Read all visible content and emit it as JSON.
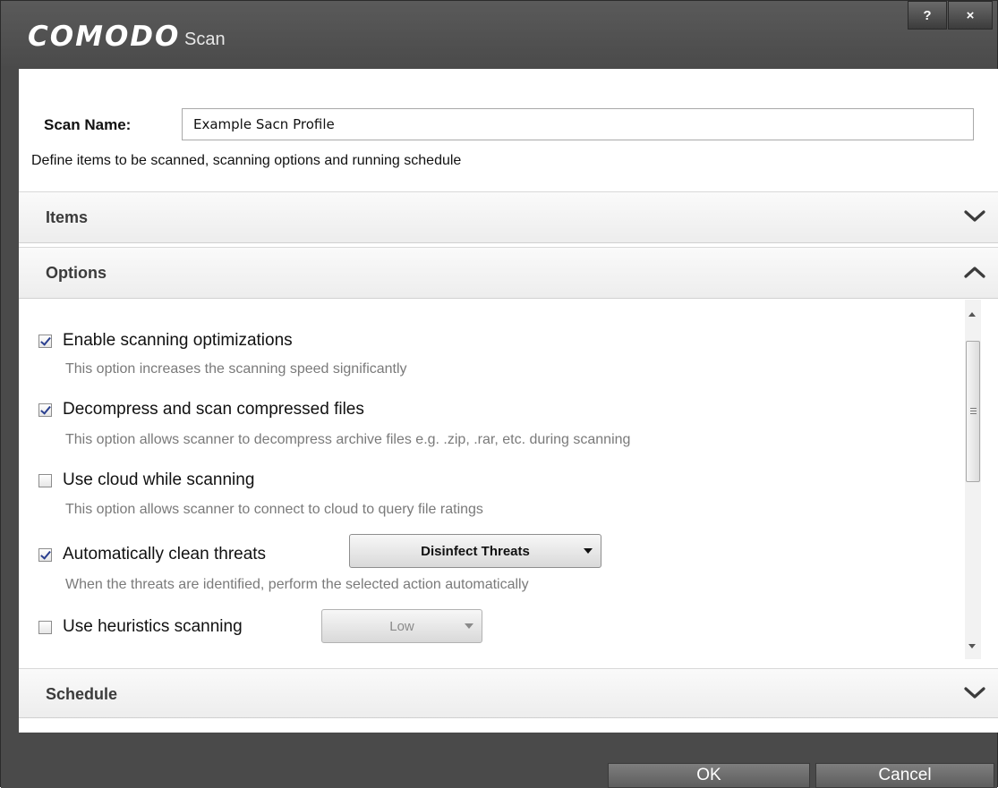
{
  "window": {
    "brand": "COMODO",
    "title": "Scan",
    "help_label": "?",
    "close_label": "×"
  },
  "scan": {
    "name_label": "Scan Name:",
    "name_value": "Example Sacn Profile",
    "description": "Define items to be scanned, scanning options and running schedule"
  },
  "sections": {
    "items": {
      "label": "Items",
      "state": "collapsed"
    },
    "options": {
      "label": "Options",
      "state": "expanded"
    },
    "schedule": {
      "label": "Schedule",
      "state": "collapsed"
    }
  },
  "options": [
    {
      "label": "Enable scanning optimizations",
      "checked": true,
      "description": "This option increases the scanning speed significantly"
    },
    {
      "label": "Decompress and scan compressed files",
      "checked": true,
      "description": "This option allows scanner to decompress archive files e.g. .zip, .rar, etc. during scanning"
    },
    {
      "label": "Use cloud while scanning",
      "checked": false,
      "description": "This option allows scanner to connect to cloud to query file ratings"
    },
    {
      "label": "Automatically clean threats",
      "checked": true,
      "description": "When the threats are identified, perform the selected action automatically",
      "dropdown": "Disinfect Threats"
    },
    {
      "label": "Use heuristics scanning",
      "checked": false,
      "dropdown": "Low"
    }
  ],
  "footer": {
    "ok_label": "OK",
    "cancel_label": "Cancel"
  },
  "colors": {
    "chrome": "#4a4a4a",
    "checkmark": "#2a3f8f",
    "description_text": "#7a7a7a"
  }
}
